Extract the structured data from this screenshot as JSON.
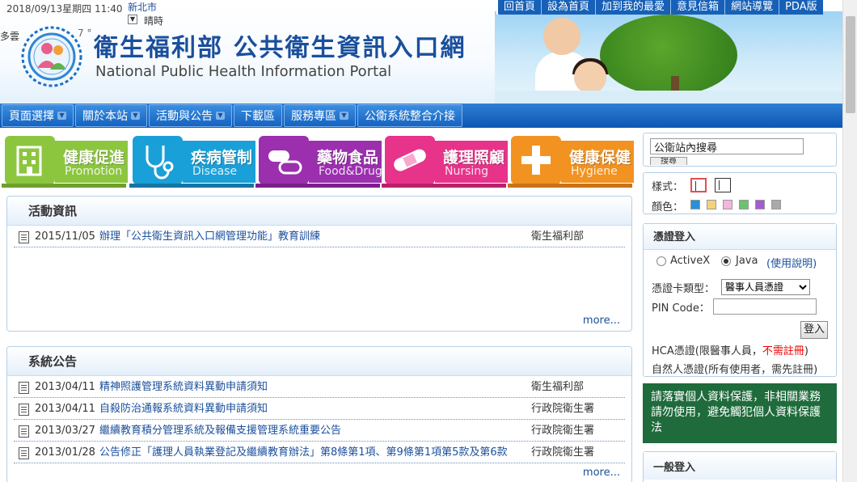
{
  "header": {
    "date": "2018/09/13星期四 11:40",
    "city": "新北市",
    "weather_dropdown": "▼",
    "weather": "晴時",
    "weather_desc": "多雲",
    "temp": "7 °",
    "title_cn": "衛生福利部 公共衛生資訊入口網",
    "title_en": "National Public Health Information Portal"
  },
  "top_links": [
    "回首頁",
    "設為首頁",
    "加到我的最愛",
    "意見信箱",
    "網站導覽",
    "PDA版"
  ],
  "nav": {
    "items": [
      {
        "label": "頁面選擇",
        "dropdown": true
      },
      {
        "label": "關於本站",
        "dropdown": true
      },
      {
        "label": "活動與公告",
        "dropdown": true
      },
      {
        "label": "下載區",
        "dropdown": false
      },
      {
        "label": "服務專區",
        "dropdown": true
      },
      {
        "label": "公衛系統整合介接",
        "dropdown": false
      }
    ]
  },
  "categories": [
    {
      "cn": "健康促進",
      "en": "Promotion",
      "color": "#8cc63f",
      "icon": "building-icon"
    },
    {
      "cn": "疾病管制",
      "en": "Disease",
      "color": "#1aa0d8",
      "icon": "stethoscope-icon"
    },
    {
      "cn": "藥物食品",
      "en": "Food&Drug",
      "color": "#9b2fae",
      "icon": "pill-icon"
    },
    {
      "cn": "護理照顧",
      "en": "Nursing",
      "color": "#e8338a",
      "icon": "bandage-icon"
    },
    {
      "cn": "健康保健",
      "en": "Hygiene",
      "color": "#f29221",
      "icon": "cross-icon"
    }
  ],
  "activities": {
    "heading": "活動資訊",
    "rows": [
      {
        "date": "2015/11/05",
        "title": "辦理「公共衛生資訊入口網管理功能」教育訓練",
        "org": "衛生福利部"
      }
    ],
    "more": "more..."
  },
  "announcements": {
    "heading": "系統公告",
    "rows": [
      {
        "date": "2013/04/11",
        "title": "精神照護管理系統資料異動申請須知",
        "org": "衛生福利部"
      },
      {
        "date": "2013/04/11",
        "title": "自殺防治通報系統資料異動申請須知",
        "org": "行政院衛生署"
      },
      {
        "date": "2013/03/27",
        "title": "繼續教育積分管理系統及報備支援管理系統重要公告",
        "org": "行政院衛生署"
      },
      {
        "date": "2013/01/28",
        "title": "公告修正「護理人員執業登記及繼續教育辦法」第8條第1項、第9條第1項第5款及第6款",
        "org": "行政院衛生署"
      }
    ],
    "more": "more..."
  },
  "search": {
    "value": "公衛站內搜尋",
    "button": "搜尋"
  },
  "style_panel": {
    "style_label": "樣式：",
    "color_label": "顏色：",
    "colors": [
      "#2a8fd9",
      "#f2d27a",
      "#f3b6e0",
      "#6cc26c",
      "#a35bd1",
      "#aaaaaa"
    ]
  },
  "cert": {
    "heading": "憑證登入",
    "activex": "ActiveX",
    "java": "Java",
    "usage": "(使用說明)",
    "type_label": "憑證卡類型：",
    "type_value": "醫事人員憑證",
    "pin_label": "PIN Code：",
    "login": "登入",
    "hca_prefix": "HCA憑證(限醫事人員，",
    "hca_red": "不需註冊",
    "hca_suffix": ")",
    "natural": "自然人憑證(所有使用者，需先註冊)"
  },
  "privacy": "請落實個人資料保護，非相關業務請勿使用，避免觸犯個人資料保護法",
  "general_login": {
    "heading": "一般登入"
  }
}
